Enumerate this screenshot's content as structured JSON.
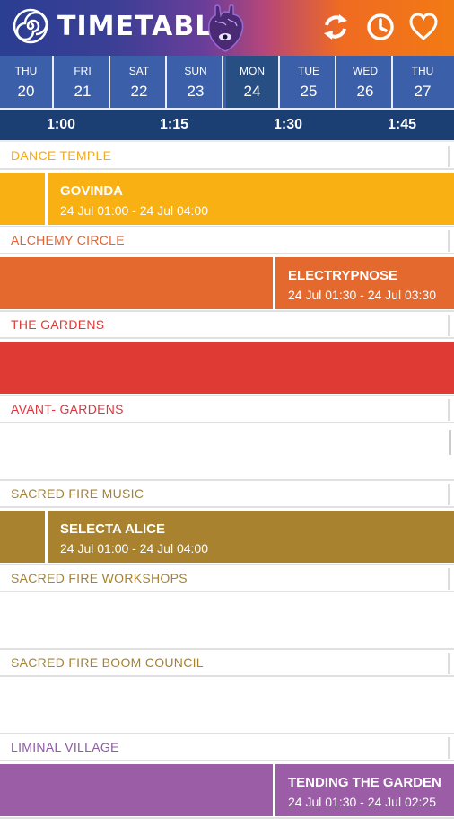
{
  "header": {
    "title": "TIMETABLE",
    "logo_icon": "spiral-icon",
    "heart_logo_icon": "anatomical-heart-icon",
    "actions": [
      {
        "name": "refresh-icon"
      },
      {
        "name": "clock-icon"
      },
      {
        "name": "favorite-heart-icon"
      }
    ]
  },
  "days": [
    {
      "name": "THU",
      "num": "20",
      "active": false
    },
    {
      "name": "FRI",
      "num": "21",
      "active": false
    },
    {
      "name": "SAT",
      "num": "22",
      "active": false
    },
    {
      "name": "SUN",
      "num": "23",
      "active": false
    },
    {
      "name": "MON",
      "num": "24",
      "active": true
    },
    {
      "name": "TUE",
      "num": "25",
      "active": false
    },
    {
      "name": "WED",
      "num": "26",
      "active": false
    },
    {
      "name": "THU",
      "num": "27",
      "active": false
    }
  ],
  "ruler": {
    "ticks": [
      "1:00",
      "1:15",
      "1:30",
      "1:45"
    ]
  },
  "stages": [
    {
      "name": "DANCE TEMPLE",
      "label_color": "#f4a81c",
      "row_color": "#f8b012",
      "events": [
        {
          "title": "GOVINDA",
          "time": "24 Jul 01:00 - 24 Jul 04:00",
          "color": "#f8b012"
        }
      ]
    },
    {
      "name": "ALCHEMY CIRCLE",
      "label_color": "#e4622e",
      "row_color": "#e4692f",
      "events": [
        {
          "title": "ELECTRYPNOSE",
          "time": "24 Jul 01:30 - 24 Jul 03:30",
          "color": "#e4692f"
        }
      ]
    },
    {
      "name": "THE GARDENS",
      "label_color": "#e03a34",
      "row_color": "#e03a34",
      "events": []
    },
    {
      "name": "AVANT- GARDENS",
      "label_color": "#e0343e",
      "row_color": "",
      "events": []
    },
    {
      "name": "SACRED FIRE MUSIC",
      "label_color": "#a8822e",
      "row_color": "#a8822e",
      "events": [
        {
          "title": "SELECTA ALICE",
          "time": "24 Jul 01:00 - 24 Jul 04:00",
          "color": "#a8822e"
        }
      ]
    },
    {
      "name": "SACRED FIRE WORKSHOPS",
      "label_color": "#a8822e",
      "row_color": "",
      "events": []
    },
    {
      "name": "SACRED FIRE BOOM COUNCIL",
      "label_color": "#a8822e",
      "row_color": "",
      "events": []
    },
    {
      "name": "LIMINAL VILLAGE",
      "label_color": "#8c5ba6",
      "row_color": "#9b5da6",
      "events": [
        {
          "title": "TENDING THE GARDEN",
          "time": "24 Jul 01:30 - 24 Jul 02:25",
          "color": "#9b5da6"
        }
      ]
    }
  ]
}
